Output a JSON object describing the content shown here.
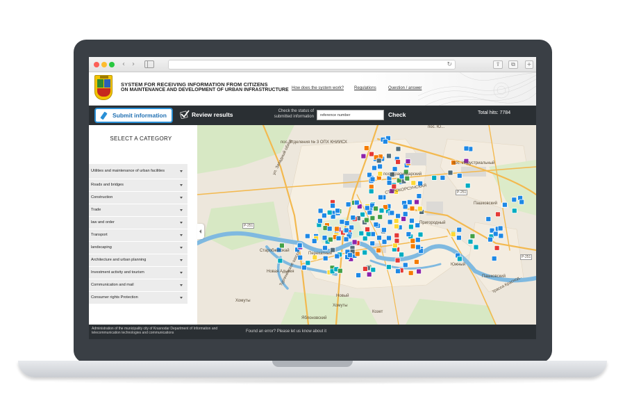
{
  "browser": {
    "back_icon": "‹",
    "forward_icon": "›",
    "reload_icon": "↻",
    "share_icon": "⇪",
    "tabs_icon": "⧉",
    "new_tab_icon": "+"
  },
  "header": {
    "title_line1": "SYSTEM FOR RECEIVING INFORMATION FROM CITIZENS",
    "title_line2": "ON MAINTENANCE AND DEVELOPMENT OF URBAN INFRASTRUCTURE",
    "links": [
      "How does the system work?",
      "Regulations",
      "Question / answer"
    ]
  },
  "actionbar": {
    "submit_label": "Submit information",
    "review_label": "Review results",
    "status_label": "Check the status of submitted information",
    "reference_value": "reference number",
    "check_label": "Check",
    "total_hits": "Total hits: 7784"
  },
  "sidebar": {
    "title": "SELECT A CATEGORY",
    "categories": [
      "Utilities and maintenance of urban facilities",
      "Roads and bridges",
      "Construction",
      "Trade",
      "law and order",
      "Transport",
      "landscaping",
      "Architecture and urban planning",
      "Investment activity and tourism",
      "Communication and mail",
      "Consumer rights Protection"
    ]
  },
  "map": {
    "labels": [
      "пос. отделения № 3 ОПХ КНИИСХ",
      "ул. Западный обход",
      "пос. Индустриальный",
      "СТАРОКОРСУНСКАЯ",
      "пос. Краснодарский",
      "Пашковский",
      "Пашковский",
      "Пригородный",
      "Старобжегокай",
      "Новая Адыгея",
      "Хомуты",
      "Яблоновский",
      "Козет",
      "Тургеневское шоссе",
      "трасса Краснод..",
      "Новый",
      "Перекатный",
      "Южный",
      "пос. Ю...",
      "Хомуты",
      "Р-251",
      "Р-251",
      "Р-251"
    ],
    "marker_colors": {
      "blue": "#1e88e5",
      "cyan": "#00acc1",
      "orange": "#f57c00",
      "red": "#e53935",
      "green": "#43a047",
      "gray": "#546e7a",
      "purple": "#8e24aa",
      "yellow": "#fdd835"
    }
  },
  "footer": {
    "org": "Administration of the municipality city of Krasnodar Department of Information and telecommunication technologies and communications",
    "error_text": "Found an error? Please let us know about it"
  }
}
